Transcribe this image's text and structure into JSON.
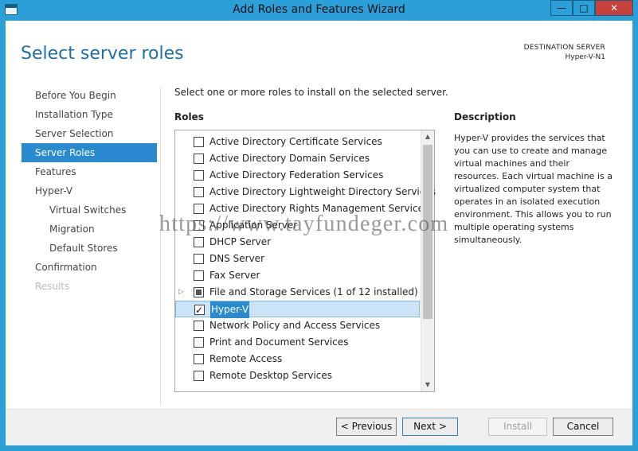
{
  "window": {
    "title": "Add Roles and Features Wizard",
    "controls": {
      "minimize": "—",
      "maximize": "□",
      "close": "✕"
    }
  },
  "header": {
    "title": "Select server roles",
    "destination_label": "DESTINATION SERVER",
    "destination_value": "Hyper-V-N1"
  },
  "nav": {
    "items": [
      {
        "label": "Before You Begin",
        "state": "normal"
      },
      {
        "label": "Installation Type",
        "state": "normal"
      },
      {
        "label": "Server Selection",
        "state": "normal"
      },
      {
        "label": "Server Roles",
        "state": "active"
      },
      {
        "label": "Features",
        "state": "normal"
      },
      {
        "label": "Hyper-V",
        "state": "normal"
      },
      {
        "label": "Virtual Switches",
        "state": "sub"
      },
      {
        "label": "Migration",
        "state": "sub"
      },
      {
        "label": "Default Stores",
        "state": "sub"
      },
      {
        "label": "Confirmation",
        "state": "normal"
      },
      {
        "label": "Results",
        "state": "disabled"
      }
    ]
  },
  "main": {
    "intro": "Select one or more roles to install on the selected server.",
    "roles_label": "Roles",
    "roles": [
      {
        "label": "Active Directory Certificate Services",
        "state": "unchecked"
      },
      {
        "label": "Active Directory Domain Services",
        "state": "unchecked"
      },
      {
        "label": "Active Directory Federation Services",
        "state": "unchecked"
      },
      {
        "label": "Active Directory Lightweight Directory Services",
        "state": "unchecked"
      },
      {
        "label": "Active Directory Rights Management Services",
        "state": "unchecked"
      },
      {
        "label": "Application Server",
        "state": "unchecked"
      },
      {
        "label": "DHCP Server",
        "state": "unchecked"
      },
      {
        "label": "DNS Server",
        "state": "unchecked"
      },
      {
        "label": "Fax Server",
        "state": "unchecked"
      },
      {
        "label": "File and Storage Services (1 of 12 installed)",
        "state": "partial",
        "expander": "▷"
      },
      {
        "label": "Hyper-V",
        "state": "checked",
        "selected": true
      },
      {
        "label": "Network Policy and Access Services",
        "state": "unchecked"
      },
      {
        "label": "Print and Document Services",
        "state": "unchecked"
      },
      {
        "label": "Remote Access",
        "state": "unchecked"
      },
      {
        "label": "Remote Desktop Services",
        "state": "unchecked"
      }
    ],
    "scroll_up": "▲",
    "scroll_down": "▼"
  },
  "description": {
    "title": "Description",
    "text": "Hyper-V provides the services that you can use to create and manage virtual machines and their resources. Each virtual machine is a virtualized computer system that operates in an isolated execution environment. This allows you to run multiple operating systems simultaneously."
  },
  "watermark": "https://www.tayfundeger.com",
  "footer": {
    "previous": "< Previous",
    "next": "Next >",
    "install": "Install",
    "cancel": "Cancel"
  },
  "colors": {
    "title_bar": "#2a9fd8",
    "accent": "#2a8ad0",
    "header_title": "#1e6fa6",
    "close_button": "#c7403a"
  }
}
